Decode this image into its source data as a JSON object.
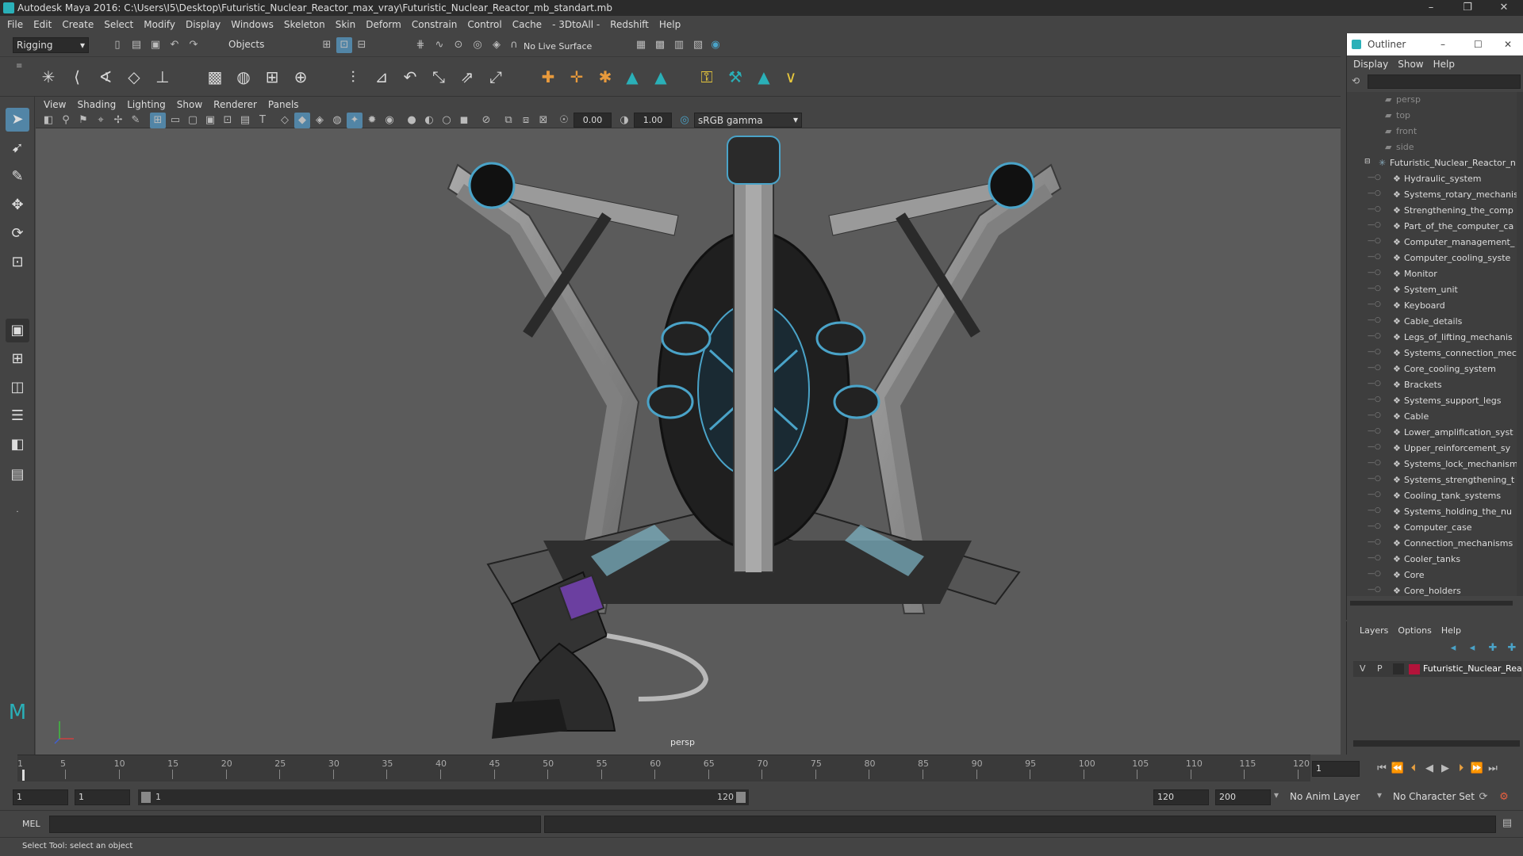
{
  "window": {
    "title": "Autodesk Maya 2016: C:\\Users\\I5\\Desktop\\Futuristic_Nuclear_Reactor_max_vray\\Futuristic_Nuclear_Reactor_mb_standart.mb",
    "minimize": "–",
    "maximize": "❐",
    "close": "✕"
  },
  "menubar": [
    "File",
    "Edit",
    "Create",
    "Select",
    "Modify",
    "Display",
    "Windows",
    "Skeleton",
    "Skin",
    "Deform",
    "Constrain",
    "Control",
    "Cache",
    "- 3DtoAll -",
    "Redshift",
    "Help"
  ],
  "statusline": {
    "mode": "Rigging",
    "selection_mode": "Objects",
    "live_surface": "No Live Surface"
  },
  "viewport": {
    "menu": [
      "View",
      "Shading",
      "Lighting",
      "Show",
      "Renderer",
      "Panels"
    ],
    "exposure": "0.00",
    "gamma": "1.00",
    "color_space": "sRGB gamma",
    "camera_label": "persp"
  },
  "outliner": {
    "title": "Outliner",
    "menu": [
      "Display",
      "Show",
      "Help"
    ],
    "cameras": [
      "persp",
      "top",
      "front",
      "side"
    ],
    "root": "Futuristic_Nuclear_Reactor_n",
    "children": [
      "Hydraulic_system",
      "Systems_rotary_mechanis",
      "Strengthening_the_comp",
      "Part_of_the_computer_ca",
      "Computer_management_",
      "Computer_cooling_syste",
      "Monitor",
      "System_unit",
      "Keyboard",
      "Cable_details",
      "Legs_of_lifting_mechanis",
      "Systems_connection_mec",
      "Core_cooling_system",
      "Brackets",
      "Systems_support_legs",
      "Cable",
      "Lower_amplification_syst",
      "Upper_reinforcement_sy",
      "Systems_lock_mechanism",
      "Systems_strengthening_t",
      "Cooling_tank_systems",
      "Systems_holding_the_nu",
      "Computer_case",
      "Connection_mechanisms",
      "Cooler_tanks",
      "Core",
      "Core_holders"
    ]
  },
  "layers": {
    "menu": [
      "Layers",
      "Options",
      "Help"
    ],
    "row": {
      "v": "V",
      "p": "P",
      "name": "Futuristic_Nuclear_Rea",
      "color": "#b3133a"
    }
  },
  "timeline": {
    "ticks": [
      "1",
      "5",
      "10",
      "15",
      "20",
      "25",
      "30",
      "35",
      "40",
      "45",
      "50",
      "55",
      "60",
      "65",
      "70",
      "75",
      "80",
      "85",
      "90",
      "95",
      "100",
      "105",
      "110",
      "115",
      "120"
    ],
    "current_frame": "1"
  },
  "range": {
    "start": "1",
    "playback_start": "1",
    "slider_start": "1",
    "slider_end": "120",
    "playback_end": "120",
    "end": "200",
    "anim_layer": "No Anim Layer",
    "character_set": "No Character Set"
  },
  "cmdline": {
    "label": "MEL"
  },
  "helpline": {
    "text": "Select Tool: select an object"
  },
  "colors": {
    "accent": "#4aa3c8",
    "highlight": "#5285a6"
  }
}
